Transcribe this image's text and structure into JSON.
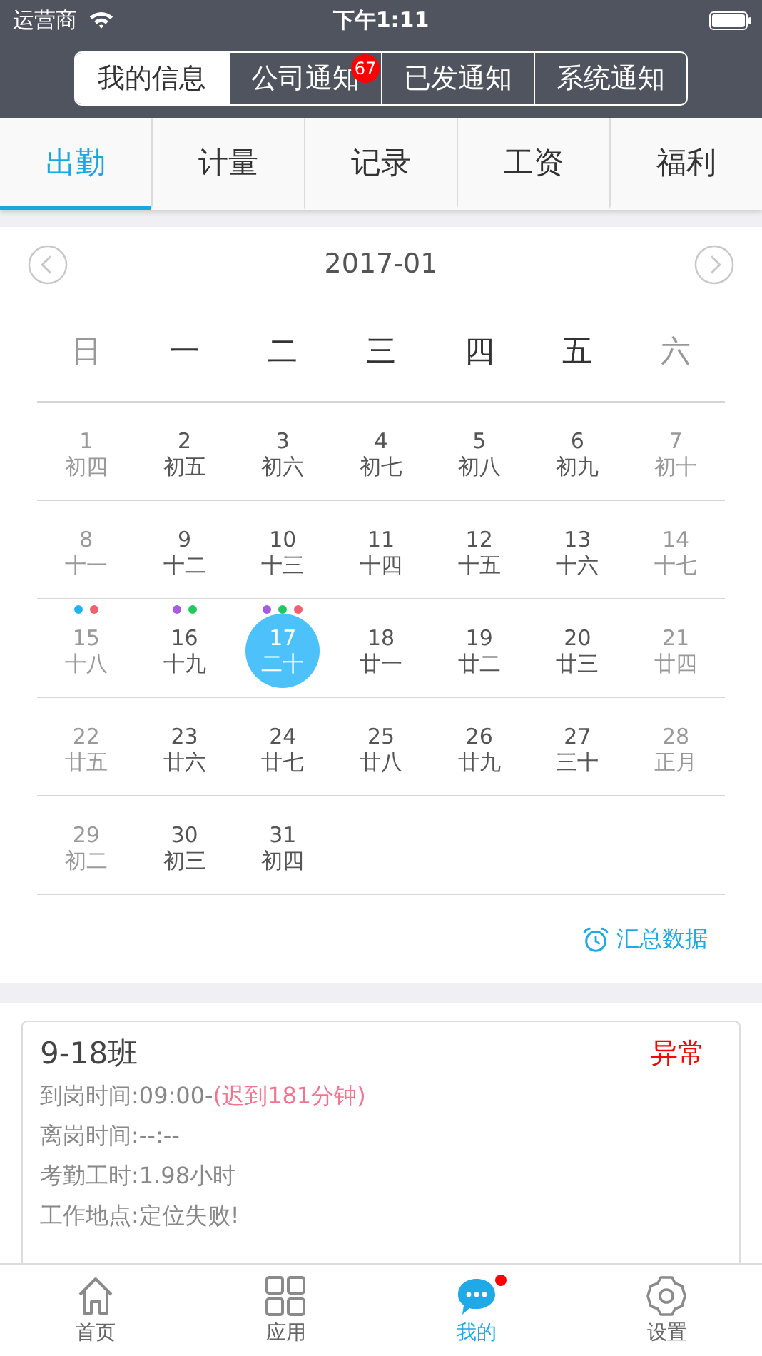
{
  "status_bar": {
    "carrier": "运营商",
    "time": "下午1:11"
  },
  "segments": [
    {
      "label": "我的信息",
      "selected": true
    },
    {
      "label": "公司通知",
      "selected": false,
      "badge": "67"
    },
    {
      "label": "已发通知",
      "selected": false
    },
    {
      "label": "系统通知",
      "selected": false
    }
  ],
  "tabs": [
    {
      "label": "出勤",
      "selected": true
    },
    {
      "label": "计量",
      "selected": false
    },
    {
      "label": "记录",
      "selected": false
    },
    {
      "label": "工资",
      "selected": false
    },
    {
      "label": "福利",
      "selected": false
    }
  ],
  "calendar": {
    "month": "2017-01",
    "weekdays": [
      {
        "label": "日",
        "dim": true
      },
      {
        "label": "一",
        "dim": false
      },
      {
        "label": "二",
        "dim": false
      },
      {
        "label": "三",
        "dim": false
      },
      {
        "label": "四",
        "dim": false
      },
      {
        "label": "五",
        "dim": false
      },
      {
        "label": "六",
        "dim": true
      }
    ],
    "weeks": [
      [
        {
          "day": "1",
          "lunar": "初四",
          "dim": true,
          "selected": false
        },
        {
          "day": "2",
          "lunar": "初五",
          "dim": false,
          "selected": false
        },
        {
          "day": "3",
          "lunar": "初六",
          "dim": false,
          "selected": false
        },
        {
          "day": "4",
          "lunar": "初七",
          "dim": false,
          "selected": false
        },
        {
          "day": "5",
          "lunar": "初八",
          "dim": false,
          "selected": false
        },
        {
          "day": "6",
          "lunar": "初九",
          "dim": false,
          "selected": false
        },
        {
          "day": "7",
          "lunar": "初十",
          "dim": true,
          "selected": false
        }
      ],
      [
        {
          "day": "8",
          "lunar": "十一",
          "dim": true,
          "selected": false
        },
        {
          "day": "9",
          "lunar": "十二",
          "dim": false,
          "selected": false
        },
        {
          "day": "10",
          "lunar": "十三",
          "dim": false,
          "selected": false
        },
        {
          "day": "11",
          "lunar": "十四",
          "dim": false,
          "selected": false
        },
        {
          "day": "12",
          "lunar": "十五",
          "dim": false,
          "selected": false
        },
        {
          "day": "13",
          "lunar": "十六",
          "dim": false,
          "selected": false
        },
        {
          "day": "14",
          "lunar": "十七",
          "dim": true,
          "selected": false
        }
      ],
      [
        {
          "day": "15",
          "lunar": "十八",
          "dim": true,
          "selected": false,
          "dots": [
            {
              "color": "#1eb4f0"
            },
            {
              "color": "#f0606e"
            }
          ]
        },
        {
          "day": "16",
          "lunar": "十九",
          "dim": false,
          "selected": false,
          "dots": [
            {
              "color": "#a65be0"
            },
            {
              "color": "#21c85e"
            }
          ]
        },
        {
          "day": "17",
          "lunar": "二十",
          "dim": false,
          "selected": true,
          "dots": [
            {
              "color": "#a65be0"
            },
            {
              "color": "#21c85e"
            },
            {
              "color": "#f0606e"
            }
          ]
        },
        {
          "day": "18",
          "lunar": "廿一",
          "dim": false,
          "selected": false
        },
        {
          "day": "19",
          "lunar": "廿二",
          "dim": false,
          "selected": false
        },
        {
          "day": "20",
          "lunar": "廿三",
          "dim": false,
          "selected": false
        },
        {
          "day": "21",
          "lunar": "廿四",
          "dim": true,
          "selected": false
        }
      ],
      [
        {
          "day": "22",
          "lunar": "廿五",
          "dim": true,
          "selected": false
        },
        {
          "day": "23",
          "lunar": "廿六",
          "dim": false,
          "selected": false
        },
        {
          "day": "24",
          "lunar": "廿七",
          "dim": false,
          "selected": false
        },
        {
          "day": "25",
          "lunar": "廿八",
          "dim": false,
          "selected": false
        },
        {
          "day": "26",
          "lunar": "廿九",
          "dim": false,
          "selected": false
        },
        {
          "day": "27",
          "lunar": "三十",
          "dim": false,
          "selected": false
        },
        {
          "day": "28",
          "lunar": "正月",
          "dim": true,
          "selected": false
        }
      ],
      [
        {
          "day": "29",
          "lunar": "初二",
          "dim": true,
          "selected": false
        },
        {
          "day": "30",
          "lunar": "初三",
          "dim": false,
          "selected": false
        },
        {
          "day": "31",
          "lunar": "初四",
          "dim": false,
          "selected": false
        }
      ]
    ],
    "summary_link": "汇总数据"
  },
  "record": {
    "shift": "9-18班",
    "status": "异常",
    "lines": [
      {
        "text": "到岗时间:09:00-",
        "note": "(迟到181分钟)"
      },
      {
        "text": "离岗时间:--:--"
      },
      {
        "text": "考勤工时:1.98小时"
      },
      {
        "text": "工作地点:定位失败!"
      }
    ]
  },
  "tab_bar": [
    {
      "kind": "home",
      "label": "首页",
      "selected": false,
      "dot": false
    },
    {
      "kind": "apps",
      "label": "应用",
      "selected": false,
      "dot": false
    },
    {
      "kind": "chat",
      "label": "我的",
      "selected": true,
      "dot": true
    },
    {
      "kind": "settings",
      "label": "设置",
      "selected": false,
      "dot": false
    }
  ]
}
